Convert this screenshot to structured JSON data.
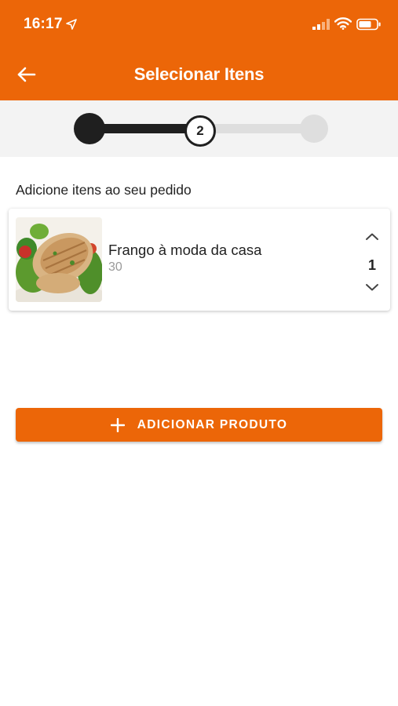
{
  "status_bar": {
    "time": "16:17",
    "icons": [
      "location-arrow-icon",
      "signal-icon",
      "wifi-icon",
      "battery-icon"
    ]
  },
  "header": {
    "title": "Selecionar Itens",
    "back_icon": "arrow-left-icon",
    "background_color": "#ec6608"
  },
  "stepper": {
    "steps": [
      {
        "state": "completed"
      },
      {
        "label": "2",
        "state": "current"
      },
      {
        "state": "pending"
      }
    ]
  },
  "section_label": "Adicione itens ao seu pedido",
  "items": [
    {
      "name": "Frango à moda da casa",
      "price": "30",
      "quantity": "1",
      "image": "grilled-chicken-salad-photo"
    }
  ],
  "add_button": {
    "label": "ADICIONAR PRODUTO",
    "icon": "plus-icon",
    "color": "#ec6608"
  }
}
